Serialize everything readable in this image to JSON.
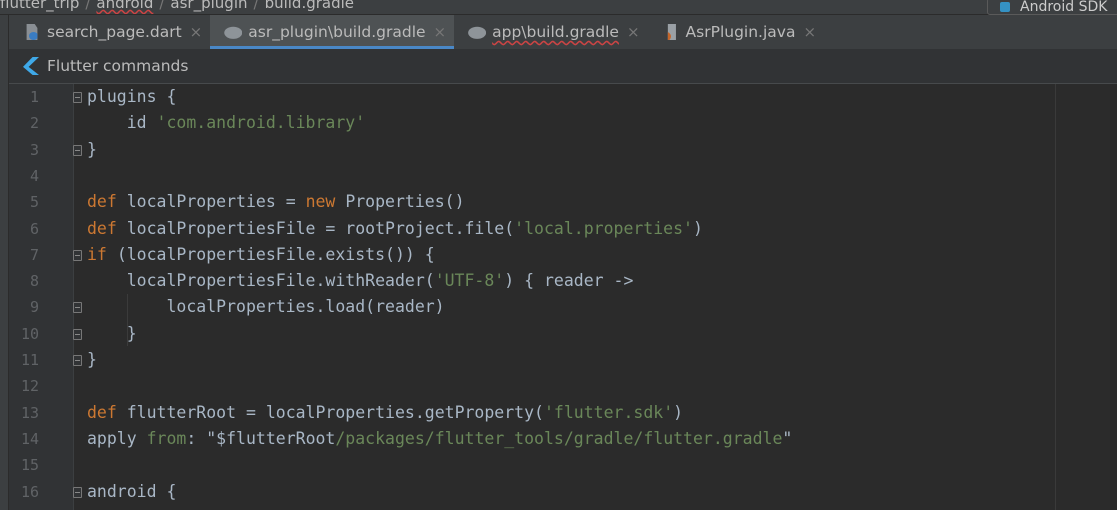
{
  "breadcrumb": [
    "flutter_trip",
    "android",
    "asr_plugin",
    "build.gradle"
  ],
  "run_config": "Android SDK",
  "tabs": [
    {
      "label": "search_page.dart",
      "icon": "dart-file-icon",
      "active": false,
      "error": false
    },
    {
      "label": "asr_plugin\\build.gradle",
      "icon": "gradle-icon",
      "active": true,
      "error": false
    },
    {
      "label": "app\\build.gradle",
      "icon": "gradle-icon",
      "active": false,
      "error": true
    },
    {
      "label": "AsrPlugin.java",
      "icon": "java-file-icon",
      "active": false,
      "error": false
    }
  ],
  "close_glyph": "×",
  "flutter_commands": "Flutter commands",
  "colors": {
    "keyword": "#cc7832",
    "string": "#6a8759",
    "plain": "#a9b7c6",
    "accent": "#4a88c7"
  },
  "lines": [
    {
      "n": "1",
      "fold": true,
      "t": [
        [
          "p",
          "plugins {"
        ]
      ]
    },
    {
      "n": "2",
      "t": [
        [
          "p",
          "    id "
        ],
        [
          "s",
          "'com.android.library'"
        ]
      ]
    },
    {
      "n": "3",
      "fold": true,
      "t": [
        [
          "p",
          "}"
        ]
      ]
    },
    {
      "n": "4",
      "t": []
    },
    {
      "n": "5",
      "t": [
        [
          "k",
          "def "
        ],
        [
          "p",
          "localProperties = "
        ],
        [
          "k",
          "new "
        ],
        [
          "p",
          "Properties()"
        ]
      ]
    },
    {
      "n": "6",
      "t": [
        [
          "k",
          "def "
        ],
        [
          "p",
          "localPropertiesFile = rootProject.file("
        ],
        [
          "s",
          "'local.properties'"
        ],
        [
          "p",
          ")"
        ]
      ]
    },
    {
      "n": "7",
      "fold": true,
      "t": [
        [
          "k",
          "if "
        ],
        [
          "p",
          "(localPropertiesFile.exists()) {"
        ]
      ]
    },
    {
      "n": "8",
      "t": [
        [
          "p",
          "    localPropertiesFile.withReader("
        ],
        [
          "s",
          "'UTF-8'"
        ],
        [
          "p",
          ") { reader ->"
        ]
      ]
    },
    {
      "n": "9",
      "fold": true,
      "t": [
        [
          "p",
          "        localProperties.load(reader)"
        ]
      ]
    },
    {
      "n": "10",
      "fold": true,
      "t": [
        [
          "p",
          "    }"
        ]
      ]
    },
    {
      "n": "11",
      "fold": true,
      "t": [
        [
          "p",
          "}"
        ]
      ]
    },
    {
      "n": "12",
      "t": []
    },
    {
      "n": "13",
      "t": [
        [
          "k",
          "def "
        ],
        [
          "p",
          "flutterRoot = localProperties.getProperty("
        ],
        [
          "s",
          "'flutter.sdk'"
        ],
        [
          "p",
          ")"
        ]
      ]
    },
    {
      "n": "14",
      "t": [
        [
          "p",
          "apply "
        ],
        [
          "s",
          "from"
        ],
        [
          "p",
          ": \"$flutterRoot"
        ],
        [
          "s",
          "/packages/flutter_tools/gradle/flutter.gradle"
        ],
        [
          "p",
          "\""
        ]
      ]
    },
    {
      "n": "15",
      "t": []
    },
    {
      "n": "16",
      "fold": true,
      "t": [
        [
          "p",
          "android {"
        ]
      ]
    }
  ]
}
